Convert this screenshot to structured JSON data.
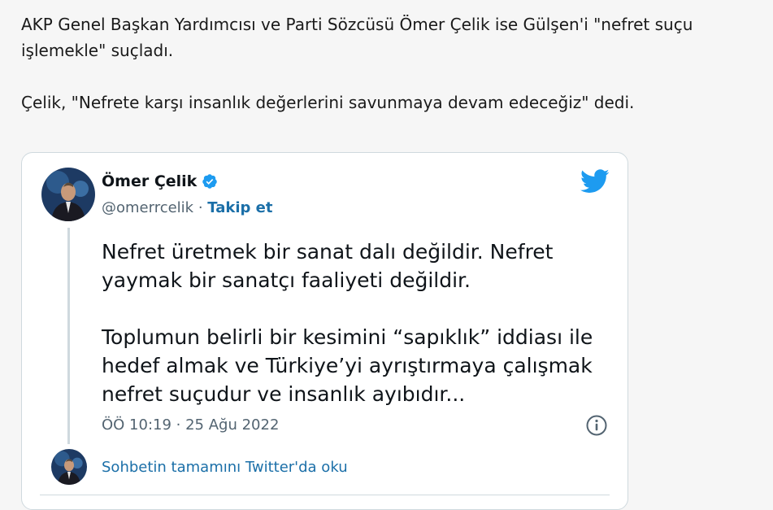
{
  "article": {
    "paragraph1": "AKP Genel Başkan Yardımcısı ve Parti Sözcüsü Ömer Çelik ise Gülşen'i \"nefret suçu işlemekle\" suçladı.",
    "paragraph2": "Çelik, \"Nefrete karşı insanlık değerlerini savunmaya devam edeceğiz\" dedi."
  },
  "tweet": {
    "author_name": "Ömer Çelik",
    "handle": "@omerrcelik",
    "separator": " · ",
    "follow_label": "Takip et",
    "text_paragraph1": "Nefret üretmek bir sanat dalı değildir. Nefret yaymak bir sanatçı faaliyeti değildir.",
    "text_paragraph2": "Toplumun belirli bir kesimini “sapıklık” iddiası ile hedef almak ve Türkiye’yi ayrıştırmaya çalışmak nefret suçudur ve insanlık ayıbıdır...",
    "timestamp": "ÖÖ 10:19 · 25 Ağu 2022",
    "read_more_label": "Sohbetin tamamını Twitter'da oku"
  },
  "icons": {
    "verified": "verified-badge-icon",
    "twitter": "twitter-bird-icon",
    "info": "info-icon"
  },
  "colors": {
    "link": "#1b6fa8",
    "twitter_blue": "#1d9bf0",
    "muted": "#536471"
  }
}
